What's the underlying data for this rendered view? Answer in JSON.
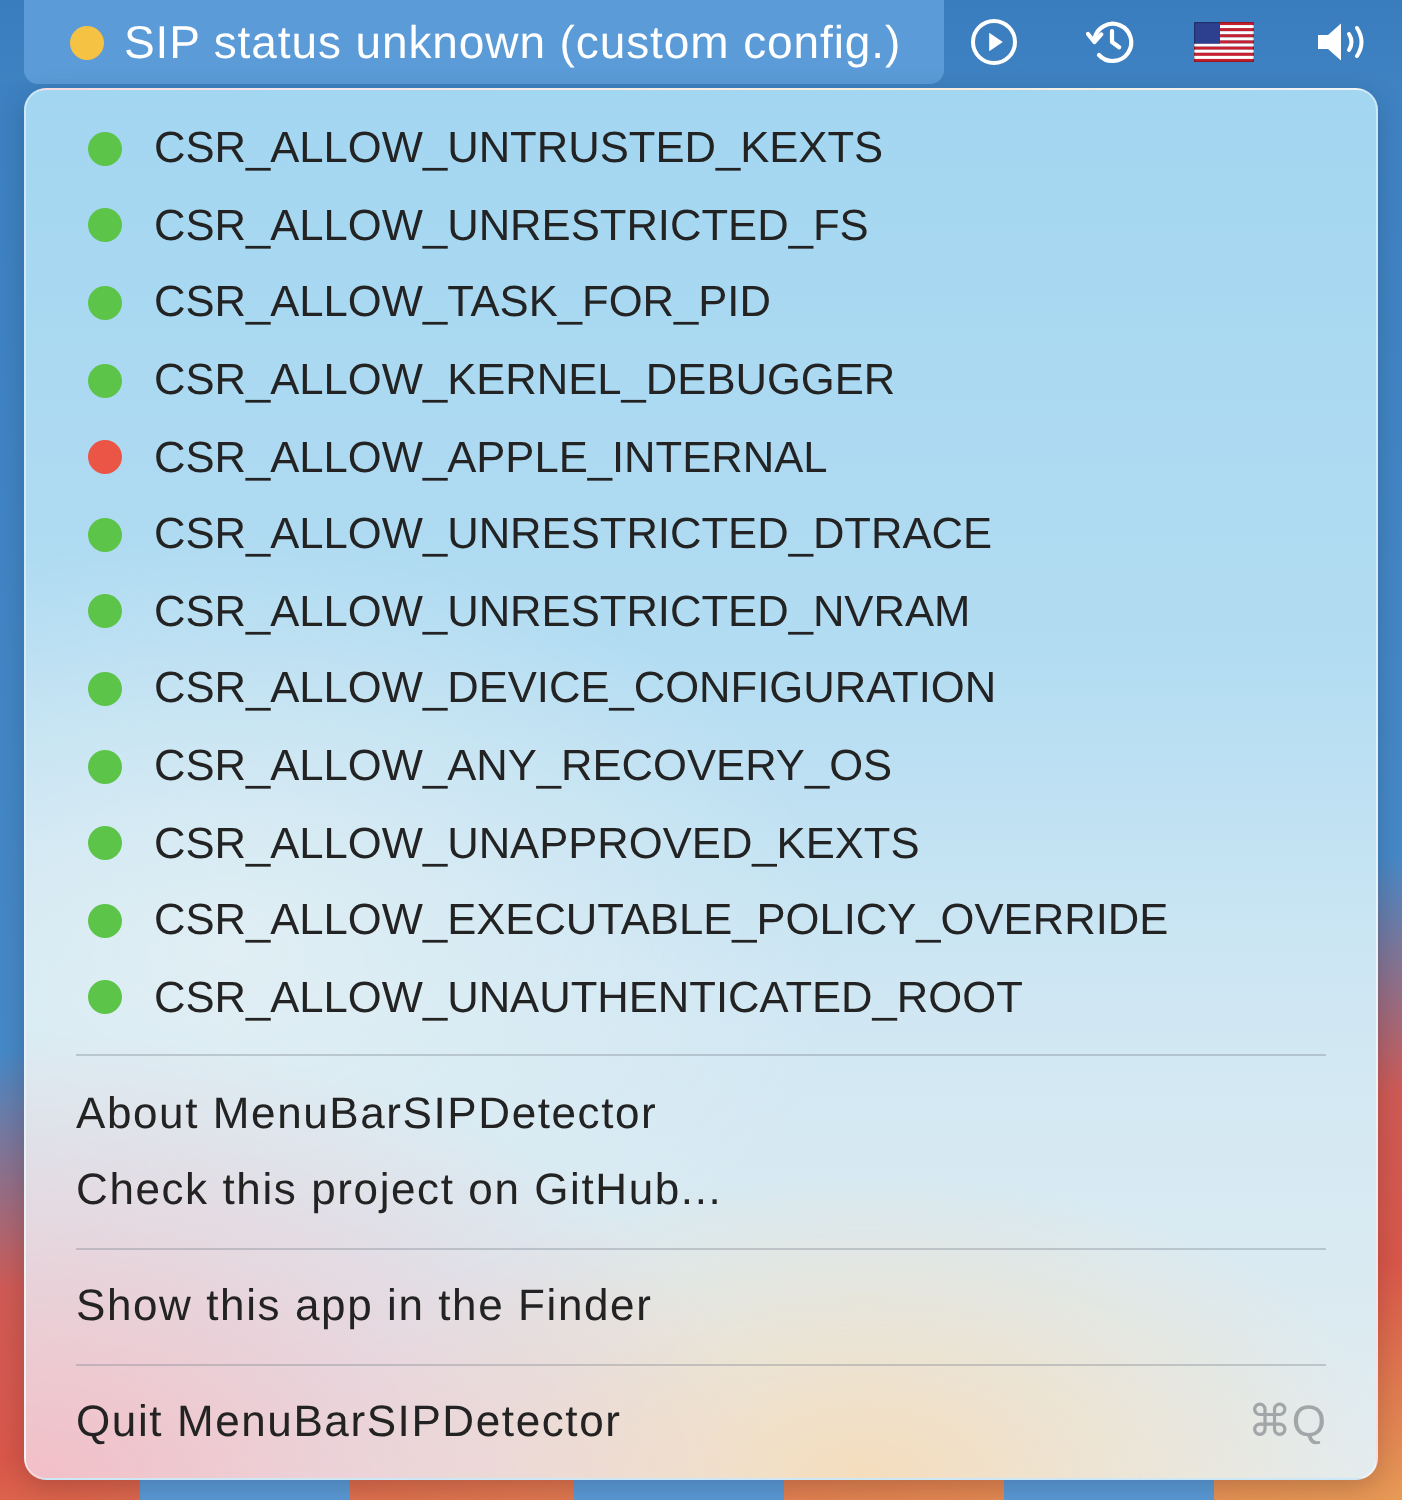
{
  "menu_bar": {
    "status_item": {
      "label": "SIP status unknown (custom config.)",
      "color": "#f6c244",
      "open": true
    }
  },
  "menu": {
    "flags": [
      {
        "label": "CSR_ALLOW_UNTRUSTED_KEXTS",
        "color": "#5cc449"
      },
      {
        "label": "CSR_ALLOW_UNRESTRICTED_FS",
        "color": "#5cc449"
      },
      {
        "label": "CSR_ALLOW_TASK_FOR_PID",
        "color": "#5cc449"
      },
      {
        "label": "CSR_ALLOW_KERNEL_DEBUGGER",
        "color": "#5cc449"
      },
      {
        "label": "CSR_ALLOW_APPLE_INTERNAL",
        "color": "#eb5545"
      },
      {
        "label": "CSR_ALLOW_UNRESTRICTED_DTRACE",
        "color": "#5cc449"
      },
      {
        "label": "CSR_ALLOW_UNRESTRICTED_NVRAM",
        "color": "#5cc449"
      },
      {
        "label": "CSR_ALLOW_DEVICE_CONFIGURATION",
        "color": "#5cc449"
      },
      {
        "label": "CSR_ALLOW_ANY_RECOVERY_OS",
        "color": "#5cc449"
      },
      {
        "label": "CSR_ALLOW_UNAPPROVED_KEXTS",
        "color": "#5cc449"
      },
      {
        "label": "CSR_ALLOW_EXECUTABLE_POLICY_OVERRIDE",
        "color": "#5cc449"
      },
      {
        "label": "CSR_ALLOW_UNAUTHENTICATED_ROOT",
        "color": "#5cc449"
      }
    ],
    "sections": [
      {
        "items": [
          {
            "label": "About MenuBarSIPDetector"
          },
          {
            "label": "Check this project on GitHub..."
          }
        ]
      },
      {
        "items": [
          {
            "label": "Show this app in the Finder"
          }
        ]
      },
      {
        "items": [
          {
            "label": "Quit MenuBarSIPDetector",
            "shortcut": "⌘Q"
          }
        ]
      }
    ]
  }
}
